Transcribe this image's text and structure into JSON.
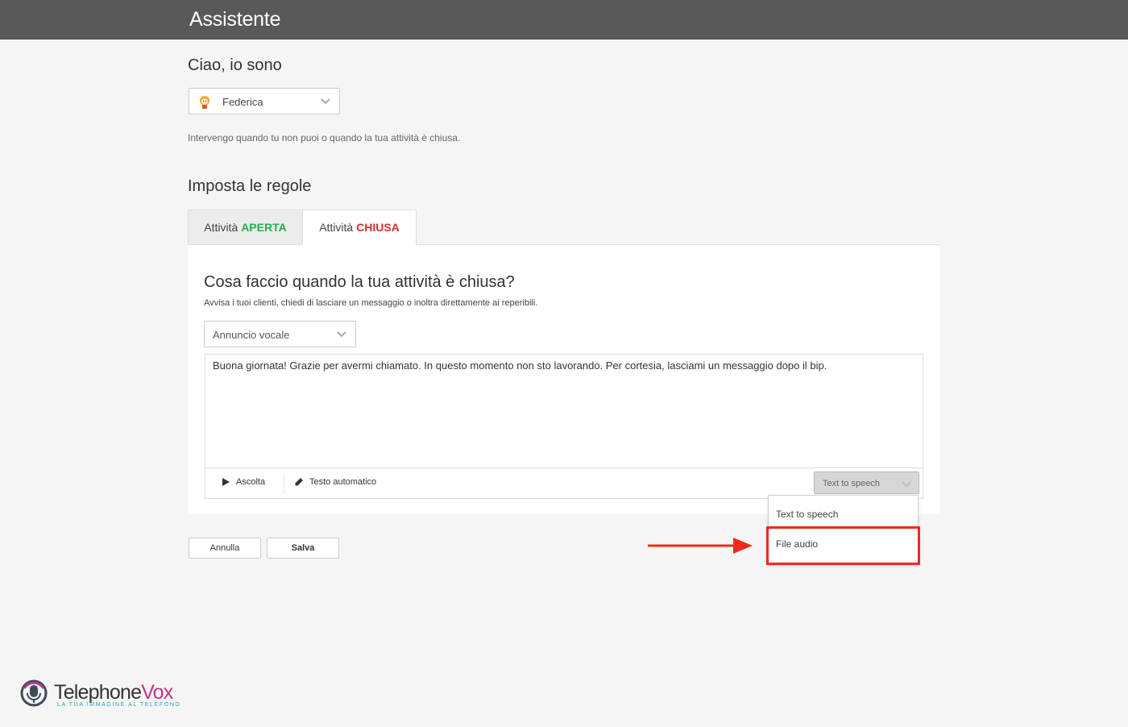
{
  "header": {
    "title": "Assistente"
  },
  "assistant": {
    "heading": "Ciao, io sono",
    "selected": "Federica",
    "description": "Intervengo quando tu non puoi o quando la tua attività è chiusa."
  },
  "rules": {
    "heading": "Imposta le regole",
    "tabs": [
      {
        "prefix": "Attività ",
        "state": "APERTA",
        "state_color": "#22b24c",
        "active": false
      },
      {
        "prefix": "Attività ",
        "state": "CHIUSA",
        "state_color": "#d0312d",
        "active": true
      }
    ]
  },
  "panel": {
    "title": "Cosa faccio quando la tua attività è chiusa?",
    "subtitle": "Avvisa i tuoi clienti, chiedi di lasciare un messaggio o inoltra direttamente ai reperibili.",
    "mode_selected": "Annuncio vocale",
    "message": "Buona giornata! Grazie per avermi chiamato. In questo momento non sto lavorando. Per cortesia, lasciami un messaggio dopo il bip.",
    "toolbar": {
      "listen_label": "Ascolta",
      "auto_text_label": "Testo automatico",
      "voice_selected": "Text to speech"
    }
  },
  "voice_dropdown": {
    "options": [
      "Text to speech",
      "File audio"
    ],
    "highlighted_option": "File audio",
    "highlight_color": "#ee2b1a"
  },
  "actions": {
    "cancel_label": "Annulla",
    "save_label": "Salva"
  },
  "brand": {
    "name": "TelephoneVox",
    "name_part1": "Telephone",
    "name_part2": "Vox",
    "tagline": "LA TUA IMMAGINE AL TELEFONO",
    "accent_color": "#c2348a"
  },
  "icons": {
    "avatar": "assistant-avatar-icon",
    "chevron": "chevron-down-icon",
    "play": "play-icon",
    "pencil": "pencil-icon",
    "logo": "microphone-logo-icon"
  }
}
